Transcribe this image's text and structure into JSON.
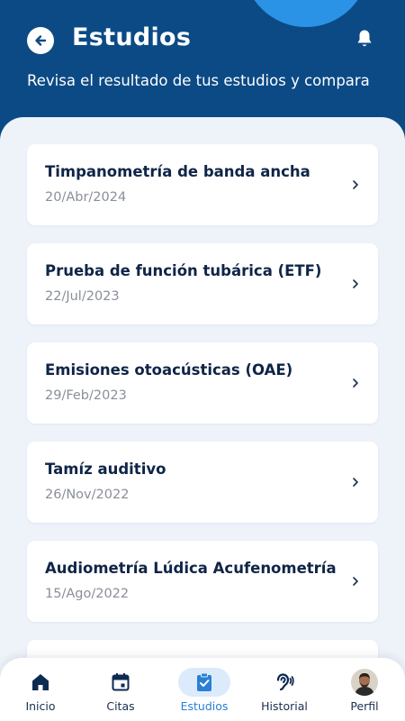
{
  "header": {
    "title": "Estudios",
    "subtitle": "Revisa el resultado de tus estudios y compara",
    "colors": {
      "background": "#0b4a85",
      "ring": "#2b93e6"
    }
  },
  "studies": [
    {
      "name": "Timpanometría de banda ancha",
      "date": "20/Abr/2024"
    },
    {
      "name": "Prueba de función tubárica (ETF)",
      "date": "22/Jul/2023"
    },
    {
      "name": "Emisiones otoacústicas (OAE)",
      "date": "29/Feb/2023"
    },
    {
      "name": "Tamíz auditivo",
      "date": "26/Nov/2022"
    },
    {
      "name": "Audiometría Lúdica Acufenometría",
      "date": "15/Ago/2022"
    },
    {
      "name": "",
      "date": ""
    }
  ],
  "nav": {
    "active": "Estudios",
    "items": [
      {
        "label": "Inicio",
        "icon": "home-icon"
      },
      {
        "label": "Citas",
        "icon": "calendar-icon"
      },
      {
        "label": "Estudios",
        "icon": "clipboard-check-icon"
      },
      {
        "label": "Historial",
        "icon": "ear-icon"
      },
      {
        "label": "Perfil",
        "icon": "avatar"
      }
    ]
  },
  "colors": {
    "content_bg": "#eef3fa",
    "card_title": "#0f2547",
    "card_date": "#8a8f98",
    "active_nav": "#2b7fd4",
    "active_pill": "#dcebfb"
  }
}
